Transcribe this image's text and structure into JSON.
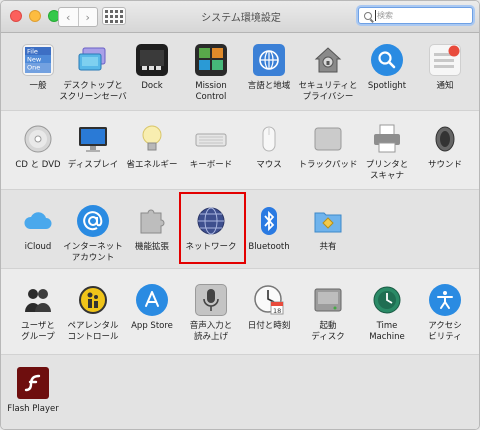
{
  "window": {
    "title": "システム環境設定",
    "search_placeholder": "検索",
    "nav": {
      "back": "‹",
      "forward": "›"
    }
  },
  "sections": [
    {
      "items": [
        {
          "id": "general",
          "label": "一般",
          "icon": "general-file-icon",
          "color": "#5a8bd6"
        },
        {
          "id": "desktop",
          "label": "デスクトップと\nスクリーンセーバ",
          "icon": "desktop-screensaver-icon",
          "color": "#7b6fd6"
        },
        {
          "id": "dock",
          "label": "Dock",
          "icon": "dock-icon",
          "color": "#2b2b2b"
        },
        {
          "id": "mission",
          "label": "Mission\nControl",
          "icon": "mission-control-icon",
          "color": "#2f4a2f"
        },
        {
          "id": "language",
          "label": "言語と地域",
          "icon": "language-region-icon",
          "color": "#3b7bd6"
        },
        {
          "id": "security",
          "label": "セキュリティと\nプライバシー",
          "icon": "house-lock-icon",
          "color": "#6b6b6b"
        },
        {
          "id": "spotlight",
          "label": "Spotlight",
          "icon": "spotlight-icon",
          "color": "#2a8be2"
        },
        {
          "id": "notifications",
          "label": "通知",
          "icon": "notifications-icon",
          "color": "#e84b3c"
        }
      ]
    },
    {
      "items": [
        {
          "id": "cddvd",
          "label": "CD と DVD",
          "icon": "cd-dvd-icon",
          "color": "#c9c9c9"
        },
        {
          "id": "displays",
          "label": "ディスプレイ",
          "icon": "display-icon",
          "color": "#2a6fd6"
        },
        {
          "id": "energy",
          "label": "省エネルギー",
          "icon": "lightbulb-icon",
          "color": "#f5e6a8"
        },
        {
          "id": "keyboard",
          "label": "キーボード",
          "icon": "keyboard-icon",
          "color": "#d9d9d9"
        },
        {
          "id": "mouse",
          "label": "マウス",
          "icon": "mouse-icon",
          "color": "#eeeeee"
        },
        {
          "id": "trackpad",
          "label": "トラックパッド",
          "icon": "trackpad-icon",
          "color": "#c8c8c8"
        },
        {
          "id": "printers",
          "label": "プリンタと\nスキャナ",
          "icon": "printer-icon",
          "color": "#8a8a8a"
        },
        {
          "id": "sound",
          "label": "サウンド",
          "icon": "speaker-icon",
          "color": "#555555"
        }
      ]
    },
    {
      "items": [
        {
          "id": "icloud",
          "label": "iCloud",
          "icon": "icloud-icon",
          "color": "#3a9be8"
        },
        {
          "id": "internet",
          "label": "インターネット\nアカウント",
          "icon": "internet-accounts-icon",
          "color": "#2a8be2"
        },
        {
          "id": "extensions",
          "label": "機能拡張",
          "icon": "puzzle-piece-icon",
          "color": "#b9b9b9"
        },
        {
          "id": "network",
          "label": "ネットワーク",
          "icon": "network-globe-icon",
          "color": "#3c4a8a"
        },
        {
          "id": "bluetooth",
          "label": "Bluetooth",
          "icon": "bluetooth-icon",
          "color": "#2a7ae2"
        },
        {
          "id": "sharing",
          "label": "共有",
          "icon": "sharing-folder-icon",
          "color": "#5fa8e8"
        }
      ]
    },
    {
      "items": [
        {
          "id": "users",
          "label": "ユーザと\nグループ",
          "icon": "users-groups-icon",
          "color": "#333333"
        },
        {
          "id": "parental",
          "label": "ペアレンタル\nコントロール",
          "icon": "parental-controls-icon",
          "color": "#e8c020"
        },
        {
          "id": "appstore",
          "label": "App Store",
          "icon": "app-store-icon",
          "color": "#2a8be2"
        },
        {
          "id": "dictation",
          "label": "音声入力と\n読み上げ",
          "icon": "microphone-icon",
          "color": "#bfbfbf"
        },
        {
          "id": "datetime",
          "label": "日付と時刻",
          "icon": "clock-calendar-icon",
          "color": "#f0f0f0"
        },
        {
          "id": "startup",
          "label": "起動\nディスク",
          "icon": "startup-disk-icon",
          "color": "#9a9a9a"
        },
        {
          "id": "timemachine",
          "label": "Time\nMachine",
          "icon": "time-machine-icon",
          "color": "#2a7f5e"
        },
        {
          "id": "accessibility",
          "label": "アクセシ\nビリティ",
          "icon": "accessibility-icon",
          "color": "#2a8be2"
        }
      ]
    },
    {
      "items": [
        {
          "id": "flash",
          "label": "Flash Player",
          "icon": "flash-player-icon",
          "color": "#7a1010"
        }
      ]
    }
  ],
  "icon_text": {
    "general_file": "File",
    "general_new": "New",
    "general_one": "One",
    "date_day": "18"
  }
}
